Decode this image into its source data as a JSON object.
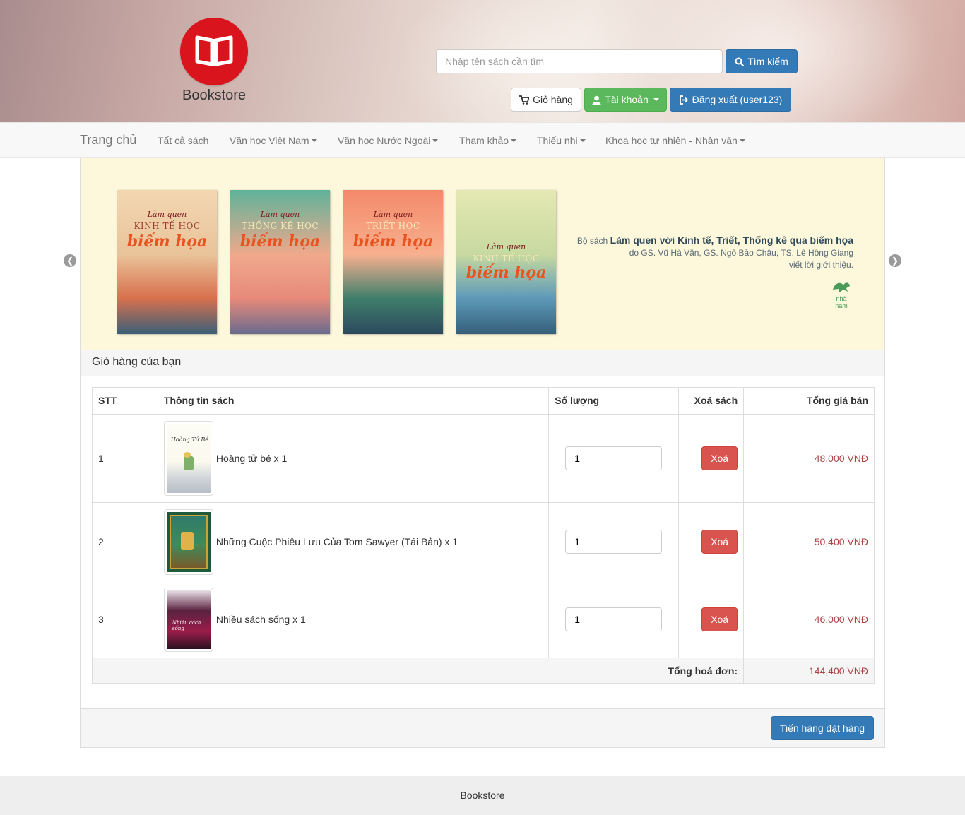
{
  "brand": {
    "name": "Bookstore",
    "logo_icon": "open-book-icon",
    "logo_color": "#d9141c"
  },
  "search": {
    "placeholder": "Nhập tên sách cần tìm",
    "button_label": "Tìm kiếm",
    "icon": "search-icon"
  },
  "actions": {
    "cart_label": "Giỏ hàng",
    "account_label": "Tài khoản",
    "logout_label": "Đăng xuất (user123)"
  },
  "nav": {
    "home": "Trang chủ",
    "items": [
      {
        "label": "Tất cả sách",
        "dropdown": false
      },
      {
        "label": "Văn học Việt Nam",
        "dropdown": true
      },
      {
        "label": "Văn học Nước Ngoài",
        "dropdown": true
      },
      {
        "label": "Tham khảo",
        "dropdown": true
      },
      {
        "label": "Thiếu nhi",
        "dropdown": true
      },
      {
        "label": "Khoa học tự nhiên - Nhân văn",
        "dropdown": true
      }
    ]
  },
  "banner": {
    "covers": [
      {
        "line1": "Làm quen",
        "line2": "KINH TẾ HỌC",
        "line3": "biếm họa"
      },
      {
        "line1": "Làm quen",
        "line2": "THỐNG KÊ HỌC",
        "line3": "biếm họa"
      },
      {
        "line1": "Làm quen",
        "line2": "TRIẾT HỌC",
        "line3": "biếm họa"
      },
      {
        "line1": "Làm quen",
        "line2": "KINH TẾ HỌC",
        "line3": "biếm họa"
      }
    ],
    "line1_prefix": "Bộ sách ",
    "line1_bold": "Làm quen với Kinh tế, Triết, Thống kê qua biếm họa",
    "line2": "do GS. Vũ Hà Văn, GS. Ngô Bảo Châu, TS. Lê Hồng Giang",
    "line3": "viết lời giới thiệu.",
    "publisher": "nhã nam"
  },
  "cart": {
    "heading": "Giỏ hàng của bạn",
    "columns": {
      "stt": "STT",
      "info": "Thông tin sách",
      "qty": "Số lượng",
      "delete": "Xoá sách",
      "total": "Tổng giá bán"
    },
    "rows": [
      {
        "stt": "1",
        "title": "Hoàng tử bé x 1",
        "qty": "1",
        "delete_label": "Xoá",
        "price": "48,000 VNĐ"
      },
      {
        "stt": "2",
        "title": "Những Cuộc Phiêu Lưu Của Tom Sawyer (Tái Bản) x 1",
        "qty": "1",
        "delete_label": "Xoá",
        "price": "50,400 VNĐ"
      },
      {
        "stt": "3",
        "title": "Nhiều sách sống x 1",
        "qty": "1",
        "delete_label": "Xoá",
        "price": "46,000 VNĐ"
      }
    ],
    "total_label": "Tổng hoá đơn:",
    "total_value": "144,400 VNĐ",
    "checkout_label": "Tiến hàng đặt hàng"
  },
  "footer": {
    "text": "Bookstore"
  },
  "colors": {
    "primary": "#337ab7",
    "success": "#5cb85c",
    "danger": "#d9534f",
    "price": "#a94442"
  }
}
